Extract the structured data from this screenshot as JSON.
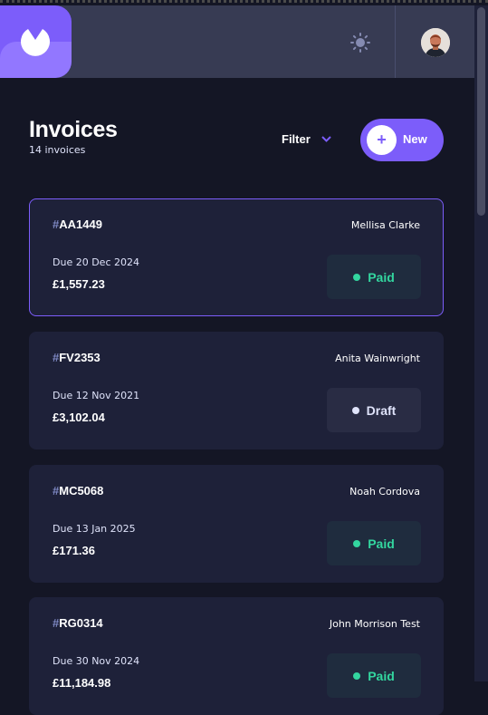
{
  "theme": {
    "accent": "#7c5dfa",
    "accent_light": "#9277ff",
    "background": "#141625",
    "card": "#1e2139",
    "paid_color": "#33d69f",
    "draft_color": "#dfe3fa"
  },
  "header": {
    "logo_icon": "logo-icon",
    "theme_toggle_icon": "sun-icon",
    "avatar_icon": "user-avatar"
  },
  "main": {
    "title": "Invoices",
    "count_text": "14 invoices",
    "filter_label": "Filter",
    "filter_icon": "chevron-down-icon",
    "new_button_label": "New",
    "new_button_icon": "+"
  },
  "invoices": [
    {
      "hash": "#",
      "id": "AA1449",
      "client": "Mellisa Clarke",
      "due": "Due 20 Dec 2024",
      "amount": "£1,557.23",
      "status": "Paid"
    },
    {
      "hash": "#",
      "id": "FV2353",
      "client": "Anita Wainwright",
      "due": "Due 12 Nov 2021",
      "amount": "£3,102.04",
      "status": "Draft"
    },
    {
      "hash": "#",
      "id": "MC5068",
      "client": "Noah Cordova",
      "due": "Due 13 Jan 2025",
      "amount": "£171.36",
      "status": "Paid"
    },
    {
      "hash": "#",
      "id": "RG0314",
      "client": "John Morrison Test",
      "due": "Due 30 Nov 2024",
      "amount": "£11,184.98",
      "status": "Paid"
    }
  ]
}
